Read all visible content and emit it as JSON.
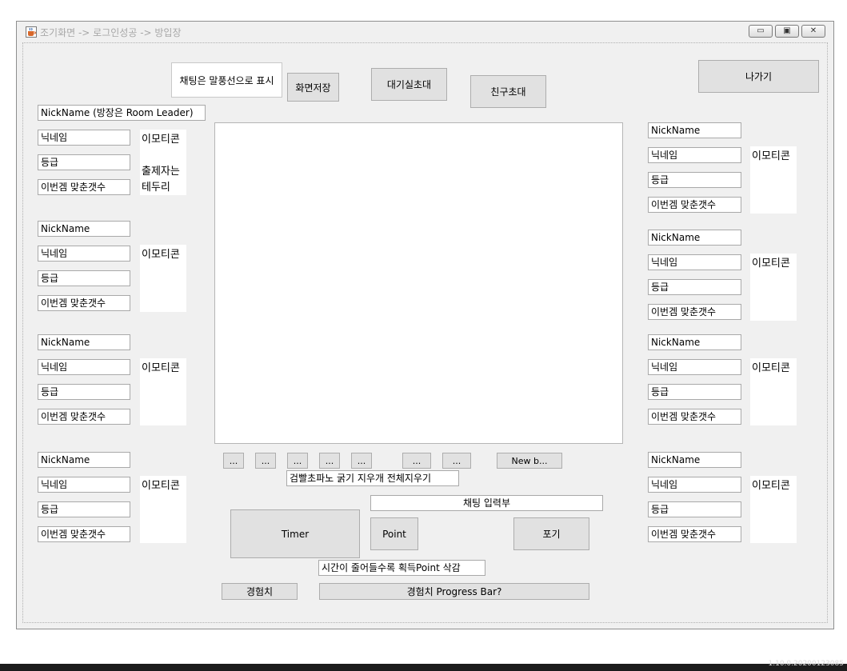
{
  "window": {
    "title": "조기화면 -> 로그인성공 -> 방입장",
    "controls": {
      "minimize": "▭",
      "maximize": "▣",
      "close": "✕"
    }
  },
  "top": {
    "speech_bubble_note": "채팅은 말풍선으로 표시",
    "screen_save": "화면저장",
    "lobby_invite": "대기실초대",
    "friend_invite": "친구초대",
    "exit": "나가기",
    "leader_nickname": "NickName (방장은 Room Leader)"
  },
  "left_players": [
    {
      "nickname": "",
      "alias": "닉네임",
      "grade": "등급",
      "correct": "이번겜 맞춘갯수",
      "emoticon": "이모티콘\n\n출제자는\n테두리"
    },
    {
      "nickname": "NickName",
      "alias": "닉네임",
      "grade": "등급",
      "correct": "이번겜 맞춘갯수",
      "emoticon": "이모티콘"
    },
    {
      "nickname": "NickName",
      "alias": "닉네임",
      "grade": "등급",
      "correct": "이번겜 맞춘갯수",
      "emoticon": "이모티콘"
    },
    {
      "nickname": "NickName",
      "alias": "닉네임",
      "grade": "등급",
      "correct": "이번겜 맞춘갯수",
      "emoticon": "이모티콘"
    }
  ],
  "right_players": [
    {
      "nickname": "NickName",
      "alias": "닉네임",
      "grade": "등급",
      "correct": "이번겜 맞춘갯수",
      "emoticon": "이모티콘"
    },
    {
      "nickname": "NickName",
      "alias": "닉네임",
      "grade": "등급",
      "correct": "이번겜 맞춘갯수",
      "emoticon": "이모티콘"
    },
    {
      "nickname": "NickName",
      "alias": "닉네임",
      "grade": "등급",
      "correct": "이번겜 맞춘갯수",
      "emoticon": "이모티콘"
    },
    {
      "nickname": "NickName",
      "alias": "닉네임",
      "grade": "등급",
      "correct": "이번겜 맞춘갯수",
      "emoticon": "이모티콘"
    }
  ],
  "tools": {
    "buttons": [
      "...",
      "...",
      "...",
      "...",
      "...",
      "...",
      "..."
    ],
    "new_button": "New b...",
    "tool_desc": "검빨초파노 굵기 지우개 전체지우기"
  },
  "bottom": {
    "chat_input": "채팅 입력부",
    "timer": "Timer",
    "point": "Point",
    "give_up": "포기",
    "time_note": "시간이 줄어들수록 획득Point 삭감",
    "exp_label": "경험치",
    "exp_bar": "경험치 Progress Bar?"
  },
  "footer": {
    "version": "1.10.0.20200123085"
  }
}
